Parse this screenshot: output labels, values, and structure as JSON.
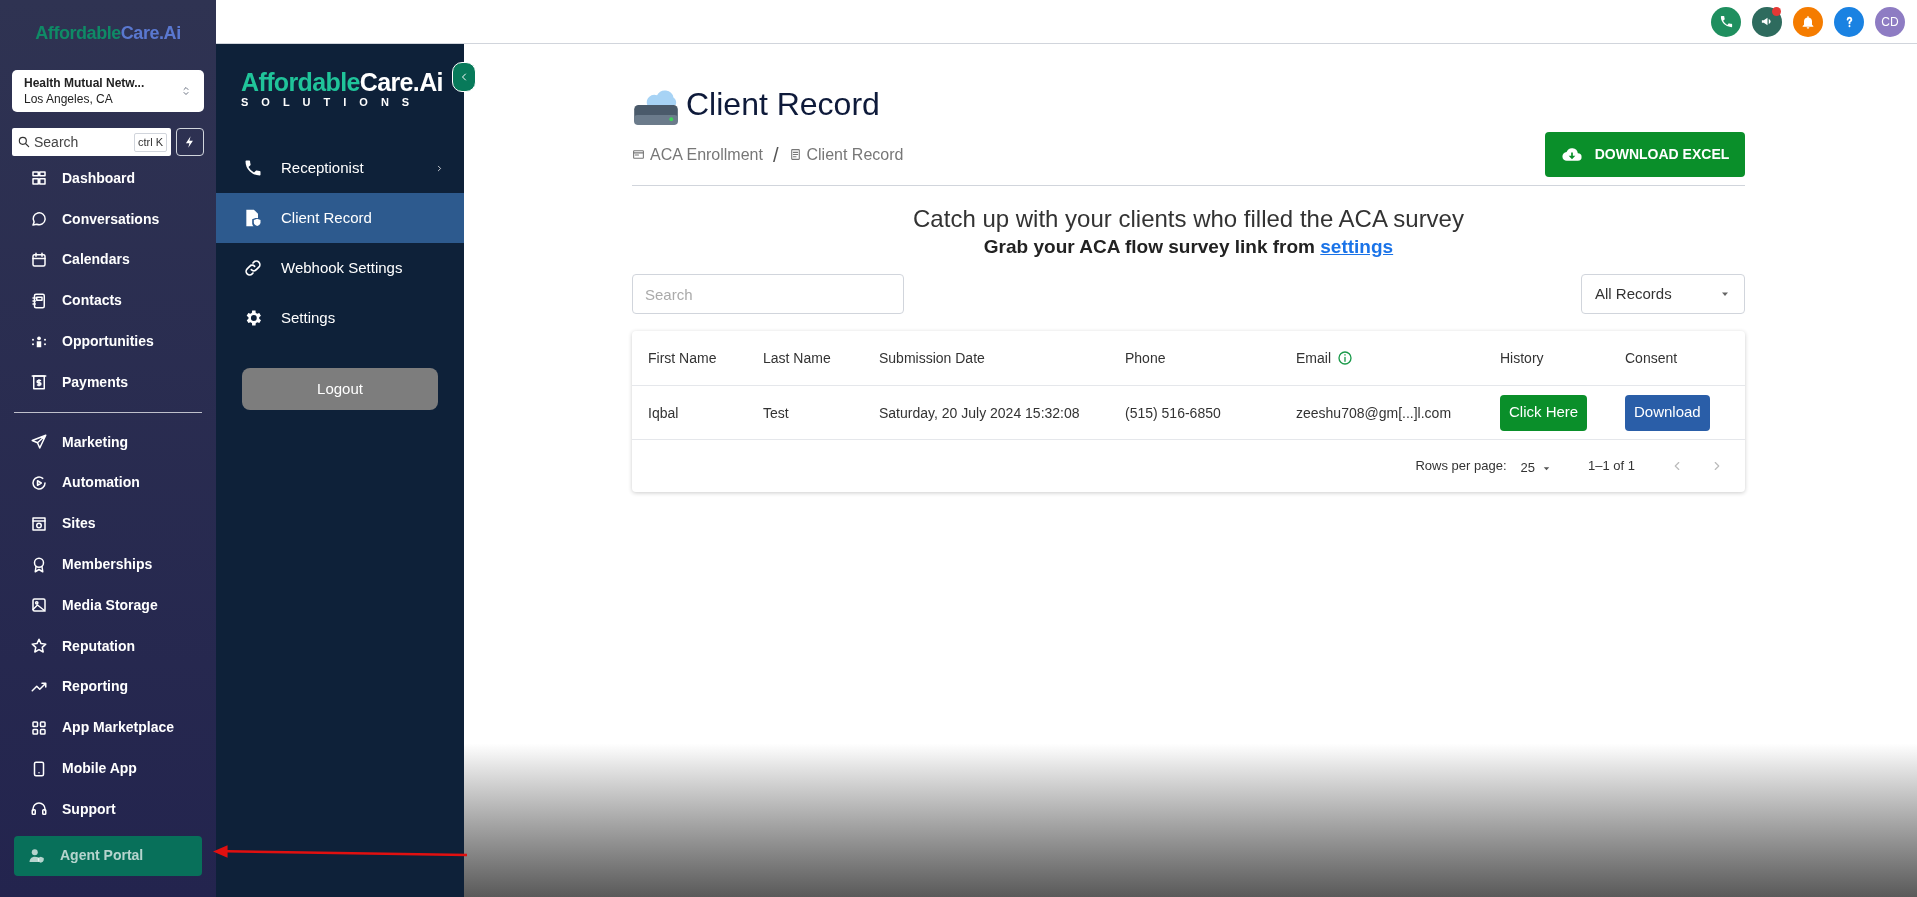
{
  "app_sidebar": {
    "logo": {
      "parts": [
        "Affordable",
        "Care.Ai"
      ]
    },
    "account": {
      "name": "Health Mutual Netw...",
      "location": "Los Angeles, CA"
    },
    "search": {
      "placeholder": "Search",
      "shortcut": "ctrl K"
    },
    "items": [
      {
        "label": "Dashboard",
        "selected": false
      },
      {
        "label": "Conversations",
        "selected": false
      },
      {
        "label": "Calendars",
        "selected": false
      },
      {
        "label": "Contacts",
        "selected": false
      },
      {
        "label": "Opportunities",
        "selected": false
      },
      {
        "label": "Payments",
        "selected": false
      },
      {
        "label": "Marketing",
        "selected": false
      },
      {
        "label": "Automation",
        "selected": false
      },
      {
        "label": "Sites",
        "selected": false
      },
      {
        "label": "Memberships",
        "selected": false
      },
      {
        "label": "Media Storage",
        "selected": false
      },
      {
        "label": "Reputation",
        "selected": false
      },
      {
        "label": "Reporting",
        "selected": false
      },
      {
        "label": "App Marketplace",
        "selected": false
      },
      {
        "label": "Mobile App",
        "selected": false
      },
      {
        "label": "Support",
        "selected": false
      },
      {
        "label": "Agent Portal",
        "selected": true
      }
    ]
  },
  "header": {
    "avatar": "CD",
    "notification_dot": true
  },
  "module_sidebar": {
    "logo": {
      "parts": [
        "Affordable",
        "Care.Ai"
      ],
      "tagline": "SOLUTIONS"
    },
    "items": [
      {
        "label": "Receptionist",
        "selected": false,
        "submenu": true
      },
      {
        "label": "Client Record",
        "selected": true,
        "submenu": false
      },
      {
        "label": "Webhook Settings",
        "selected": false,
        "submenu": false
      },
      {
        "label": "Settings",
        "selected": false,
        "submenu": false
      }
    ],
    "logout": "Logout"
  },
  "page": {
    "title": "Client Record",
    "breadcrumbs": [
      "ACA Enrollment",
      "Client Record"
    ],
    "breadcrumb_separator": "/",
    "download_button": "DOWNLOAD EXCEL",
    "heading": "Catch up with your clients who filled the ACA survey",
    "subheading": "Grab your ACA flow survey link from",
    "subheading_link": "settings",
    "search": {
      "placeholder": "Search"
    },
    "filter": "All Records",
    "table": {
      "columns": [
        "First Name",
        "Last Name",
        "Submission Date",
        "Phone",
        "Email",
        "History",
        "Consent"
      ],
      "rows": [
        {
          "first_name": "Iqbal",
          "last_name": "Test",
          "submission_date": "Saturday, 20 July 2024 15:32:08",
          "phone": "(515) 516-6850",
          "email": "zeeshu708@gm[...]l.com",
          "history": "Click Here",
          "consent": "Download"
        }
      ],
      "rows_per_page_label": "Rows per page:",
      "rows_per_page": "25",
      "range": "1–1 of 1"
    }
  }
}
